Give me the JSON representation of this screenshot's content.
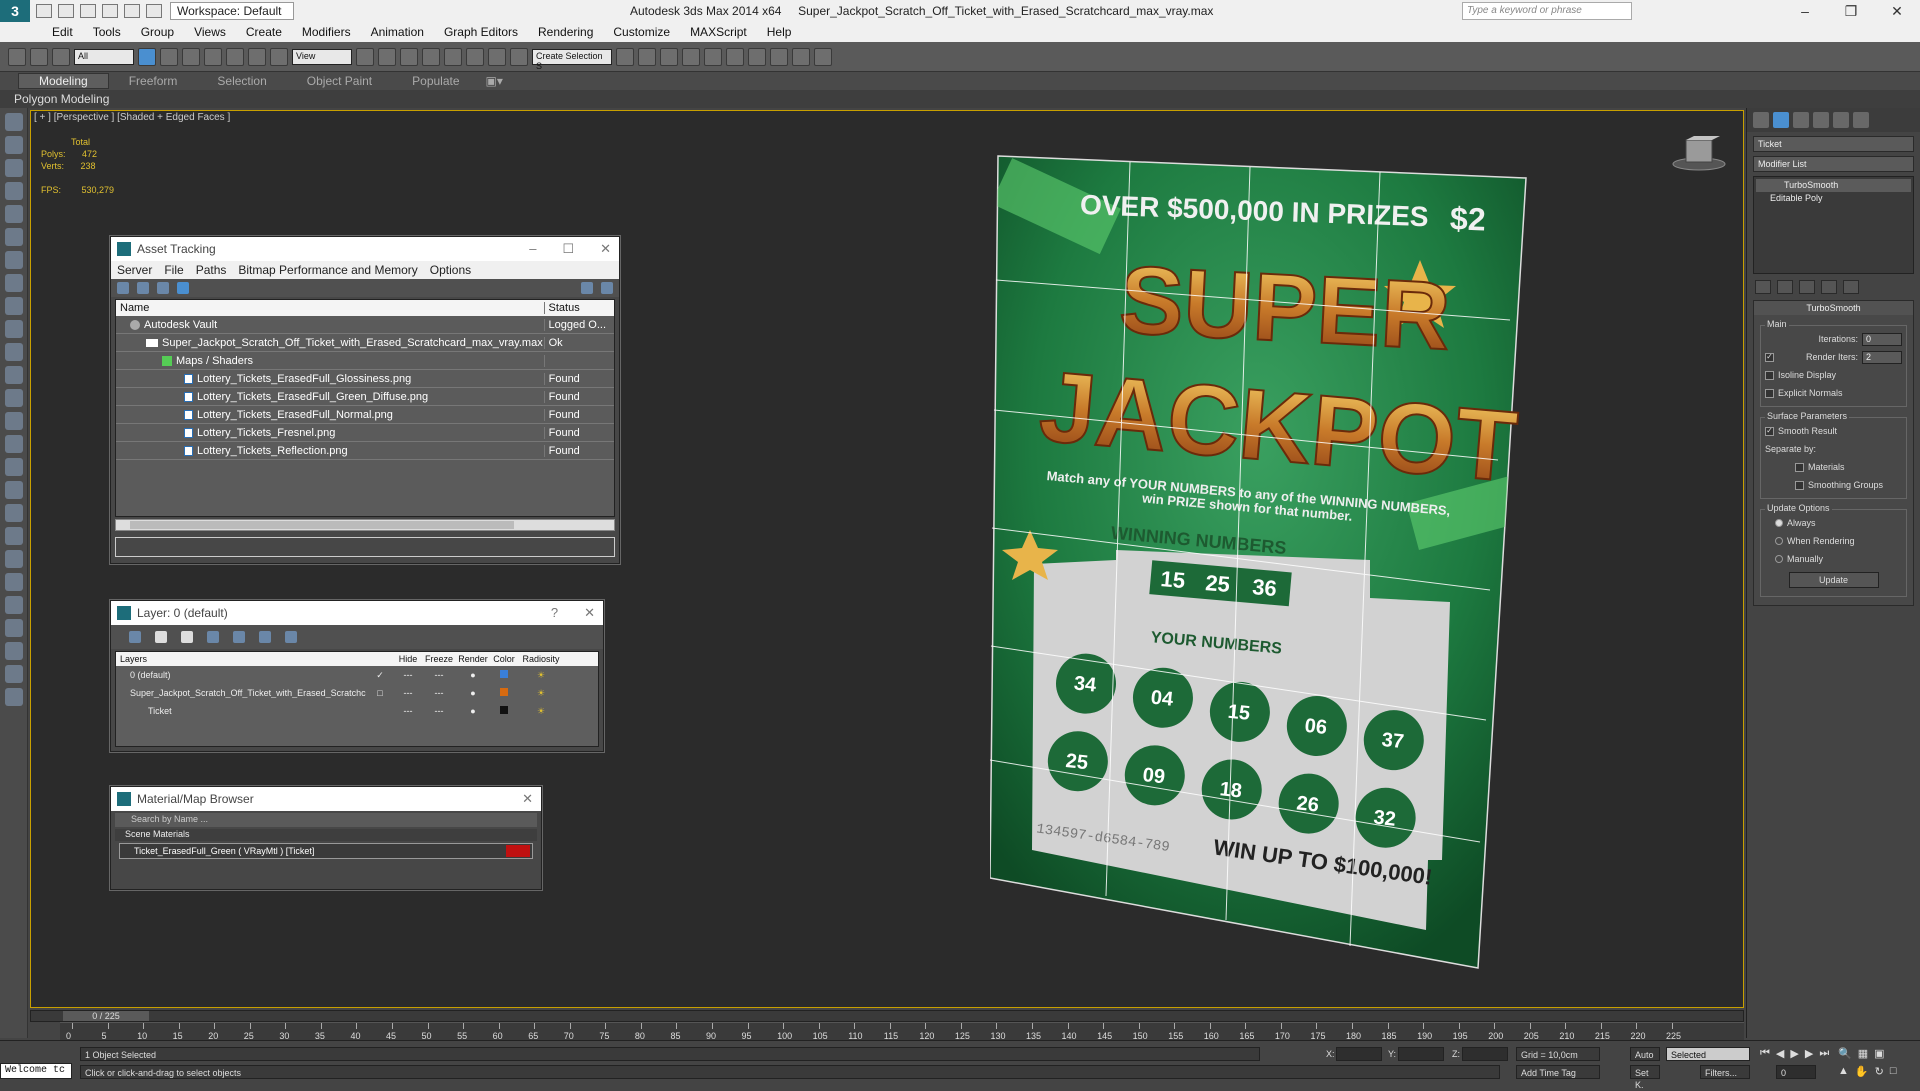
{
  "app": {
    "title": "Autodesk 3ds Max  2014 x64",
    "filename": "Super_Jackpot_Scratch_Off_Ticket_with_Erased_Scratchcard_max_vray.max",
    "workspace": "Workspace: Default",
    "search_placeholder": "Type a keyword or phrase"
  },
  "menu": [
    "Edit",
    "Tools",
    "Group",
    "Views",
    "Create",
    "Modifiers",
    "Animation",
    "Graph Editors",
    "Rendering",
    "Customize",
    "MAXScript",
    "Help"
  ],
  "toolbar": {
    "selection_filter": "All",
    "ref_coord": "View",
    "named_selection": "Create Selection S"
  },
  "ribbon": {
    "tabs": [
      "Modeling",
      "Freeform",
      "Selection",
      "Object Paint",
      "Populate"
    ],
    "active": "Modeling",
    "subtitle": "Polygon Modeling"
  },
  "viewport": {
    "label": "[ + ] [Perspective ] [Shaded + Edged Faces ]",
    "stats": {
      "total_label": "Total",
      "polys_label": "Polys:",
      "polys": "472",
      "verts_label": "Verts:",
      "verts": "238",
      "fps_label": "FPS:",
      "fps": "530,279"
    }
  },
  "ticket": {
    "header": "OVER $500,000 IN PRIZES",
    "price": "$2",
    "title1": "SUPER",
    "title2": "JACKPOT",
    "instructions": "Match any of YOUR NUMBERS to any of the WINNING NUMBERS, win PRIZE shown for that number.",
    "winning_label": "WINNING NUMBERS",
    "winning_numbers": [
      "15",
      "25",
      "36"
    ],
    "your_label": "YOUR NUMBERS",
    "your_numbers": [
      "34",
      "04",
      "15",
      "06",
      "37",
      "25",
      "09",
      "18",
      "26",
      "32"
    ],
    "serial": "134597-d6584-789",
    "win_up_to": "WIN UP TO $100,000!"
  },
  "asset_tracking": {
    "title": "Asset Tracking",
    "menu": [
      "Server",
      "File",
      "Paths",
      "Bitmap Performance and Memory",
      "Options"
    ],
    "columns": [
      "Name",
      "Status"
    ],
    "rows": [
      {
        "name": "Autodesk Vault",
        "status": "Logged O..."
      },
      {
        "name": "Super_Jackpot_Scratch_Off_Ticket_with_Erased_Scratchcard_max_vray.max",
        "status": "Ok"
      },
      {
        "name": "Maps / Shaders",
        "status": ""
      },
      {
        "name": "Lottery_Tickets_ErasedFull_Glossiness.png",
        "status": "Found"
      },
      {
        "name": "Lottery_Tickets_ErasedFull_Green_Diffuse.png",
        "status": "Found"
      },
      {
        "name": "Lottery_Tickets_ErasedFull_Normal.png",
        "status": "Found"
      },
      {
        "name": "Lottery_Tickets_Fresnel.png",
        "status": "Found"
      },
      {
        "name": "Lottery_Tickets_Reflection.png",
        "status": "Found"
      }
    ]
  },
  "layer": {
    "title": "Layer: 0 (default)",
    "help": "?",
    "columns": [
      "Layers",
      "Hide",
      "Freeze",
      "Render",
      "Color",
      "Radiosity"
    ],
    "rows": [
      {
        "name": "0 (default)",
        "color": "#3a7fd8"
      },
      {
        "name": "Super_Jackpot_Scratch_Off_Ticket_with_Erased_Scratchcard",
        "color": "#d66a10"
      },
      {
        "name": "Ticket",
        "color": "#111111"
      }
    ]
  },
  "material_browser": {
    "title": "Material/Map Browser",
    "search_placeholder": "Search by Name ...",
    "group": "Scene Materials",
    "item": "Ticket_ErasedFull_Green  ( VRayMtl )  [Ticket]"
  },
  "command_panel": {
    "object_name": "Ticket",
    "modifier_list": "Modifier List",
    "stack": [
      "TurboSmooth",
      "Editable Poly"
    ],
    "rollout_title": "TurboSmooth",
    "main_label": "Main",
    "iterations_label": "Iterations:",
    "iterations": "0",
    "render_iters_label": "Render Iters:",
    "render_iters": "2",
    "isoline": "Isoline Display",
    "explicit_normals": "Explicit Normals",
    "surface_params": "Surface Parameters",
    "smooth_result": "Smooth Result",
    "separate_by": "Separate by:",
    "materials": "Materials",
    "smoothing_groups": "Smoothing Groups",
    "update_options": "Update Options",
    "always": "Always",
    "when_rendering": "When Rendering",
    "manually": "Manually",
    "update_btn": "Update"
  },
  "timeline": {
    "frame": "0 / 225",
    "ticks": [
      "0",
      "5",
      "10",
      "15",
      "20",
      "25",
      "30",
      "35",
      "40",
      "45",
      "50",
      "55",
      "60",
      "65",
      "70",
      "75",
      "80",
      "85",
      "90",
      "95",
      "100",
      "105",
      "110",
      "115",
      "120",
      "125",
      "130",
      "135",
      "140",
      "145",
      "150",
      "155",
      "160",
      "165",
      "170",
      "175",
      "180",
      "185",
      "190",
      "195",
      "200",
      "205",
      "210",
      "215",
      "220",
      "225"
    ]
  },
  "status": {
    "welcome": "Welcome tc",
    "selected": "1 Object Selected",
    "hint": "Click or click-and-drag to select objects",
    "x_label": "X:",
    "y_label": "Y:",
    "z_label": "Z:",
    "grid": "Grid = 10,0cm",
    "add_time_tag": "Add Time Tag",
    "auto": "Auto",
    "set_k": "Set K.",
    "key_filter": "Selected",
    "filters": "Filters...",
    "frame_field": "0"
  }
}
